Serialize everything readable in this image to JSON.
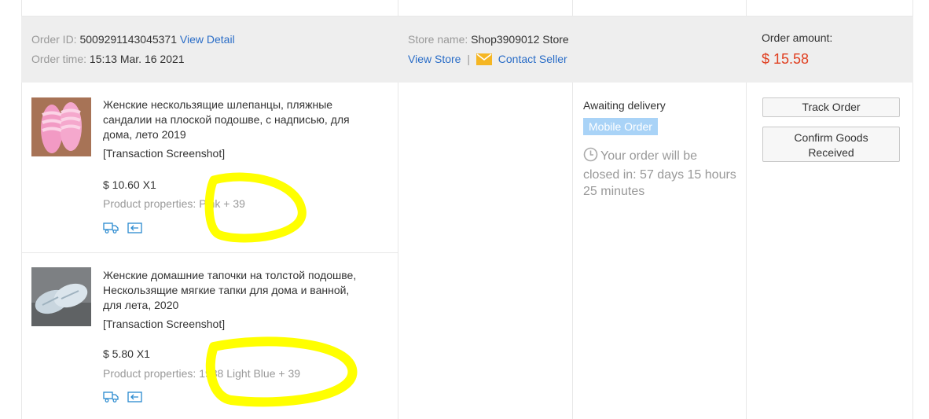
{
  "header": {
    "order_id_label": "Order ID:",
    "order_id_value": "5009291143045371",
    "view_detail": "View Detail",
    "order_time_label": "Order time:",
    "order_time_value": "15:13 Mar. 16 2021",
    "store_name_label": "Store name:",
    "store_name_value": "Shop3909012 Store",
    "view_store": "View Store",
    "separator": "|",
    "contact_seller": "Contact Seller",
    "order_amount_label": "Order amount:",
    "order_amount_value": "$ 15.58"
  },
  "items": [
    {
      "title_lines": [
        "Женские нескользящие шлепанцы, пляжные",
        "сандалии на плоской подошве, с надписью, для",
        "дома, лето 2019"
      ],
      "screenshot": "[Transaction Screenshot]",
      "price": "$ 10.60 X1",
      "props_label": "Product properties:",
      "props_value": "Pink + 39"
    },
    {
      "title_lines": [
        "Женские домашние тапочки на толстой подошве,",
        "Нескользящие мягкие тапки для дома и ванной,",
        "для лета, 2020"
      ],
      "screenshot": "[Transaction Screenshot]",
      "price": "$ 5.80 X1",
      "props_label": "Product properties:",
      "props_value": "1988 Light Blue + 39"
    }
  ],
  "status": {
    "text": "Awaiting delivery",
    "badge": "Mobile Order",
    "countdown_lines": [
      "Your order will be",
      "closed in: 57 days 15 hours",
      "25 minutes"
    ]
  },
  "actions": {
    "track_order": "Track Order",
    "confirm_line1": "Confirm Goods",
    "confirm_line2": "Received"
  },
  "colors": {
    "link": "#2a6dc7",
    "amount": "#e03e1f",
    "badge_bg": "#a9d3f7",
    "highlight": "#ffff00"
  }
}
